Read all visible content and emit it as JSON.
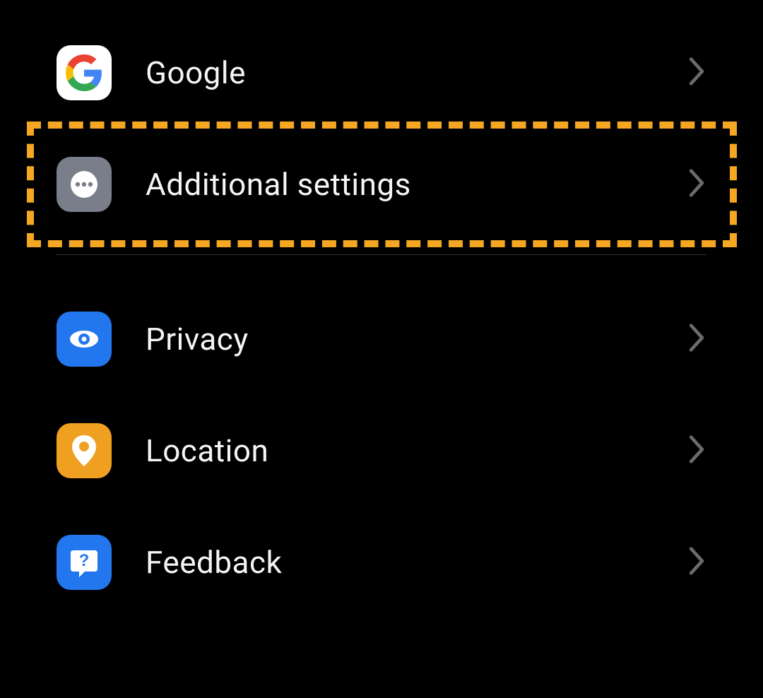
{
  "settings": {
    "items": [
      {
        "label": "Google"
      },
      {
        "label": "Additional settings"
      },
      {
        "label": "Privacy"
      },
      {
        "label": "Location"
      },
      {
        "label": "Feedback"
      }
    ]
  },
  "highlight": {
    "target": "additional-settings",
    "color": "#f5a623"
  }
}
